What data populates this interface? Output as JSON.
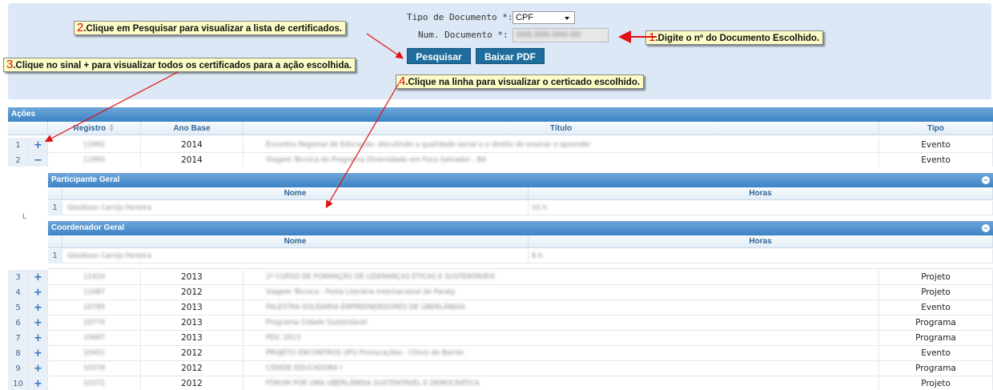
{
  "form": {
    "doc_type_label": "Tipo de Documento *:",
    "doc_type_value": "CPF",
    "doc_num_label": "Num. Documento *:",
    "doc_num_value": "000.000.000-00",
    "search_button": "Pesquisar",
    "pdf_button": "Baixar PDF"
  },
  "callouts": {
    "c1_num": "1",
    "c1_text": ".Digite o nº do Documento Escolhido.",
    "c2_num": "2",
    "c2_text": ".Clique em Pesquisar para visualizar a lista de certificados.",
    "c3_num": "3",
    "c3_text": ".Clique no sinal + para visualizar todos os certificados para a ação escolhida.",
    "c4_num": "4",
    "c4_text": ".Clique na linha para visualizar o certicado escolhido."
  },
  "grid": {
    "caption": "Ações",
    "columns": {
      "registro": "Registro",
      "sort_icon": "⇕",
      "ano_base": "Ano Base",
      "titulo": "Título",
      "tipo": "Tipo"
    },
    "rows": [
      {
        "index": "1",
        "toggle": "+",
        "registro": "11992",
        "ano": "2014",
        "titulo": "Encontro Regional de Educação: discutindo a qualidade social e o direito de ensinar e aprender",
        "tipo": "Evento"
      },
      {
        "index": "2",
        "toggle": "−",
        "registro": "11993",
        "ano": "2014",
        "titulo": "Viagem Técnica do Programa Diversidade em Foco Salvador - BA",
        "tipo": "Evento"
      },
      {
        "index": "3",
        "toggle": "+",
        "registro": "11424",
        "ano": "2013",
        "titulo": "1º CURSO DE FORMAÇÃO DE LIDERANÇAS ÉTICAS E SUSTENTÁVEIS",
        "tipo": "Projeto"
      },
      {
        "index": "4",
        "toggle": "+",
        "registro": "11087",
        "ano": "2012",
        "titulo": "Viagem Técnica - Festa Literária Internacional de Paraty",
        "tipo": "Projeto"
      },
      {
        "index": "5",
        "toggle": "+",
        "registro": "10785",
        "ano": "2013",
        "titulo": "PALESTRA SOLIDÁRIA EMPREENDEDORES DE UBERLÂNDIA",
        "tipo": "Evento"
      },
      {
        "index": "6",
        "toggle": "+",
        "registro": "10774",
        "ano": "2013",
        "titulo": "Programa Cidade Sustentável",
        "tipo": "Programa"
      },
      {
        "index": "7",
        "toggle": "+",
        "registro": "10687",
        "ano": "2013",
        "titulo": "PEIC 2013",
        "tipo": "Programa"
      },
      {
        "index": "8",
        "toggle": "+",
        "registro": "10401",
        "ano": "2012",
        "titulo": "PROJETO ENCONTROS UFU Provocações - Clóvis de Barros",
        "tipo": "Evento"
      },
      {
        "index": "9",
        "toggle": "+",
        "registro": "10378",
        "ano": "2012",
        "titulo": "CIDADE EDUCADORA I",
        "tipo": "Programa"
      },
      {
        "index": "10",
        "toggle": "+",
        "registro": "10371",
        "ano": "2012",
        "titulo": "FÓRUM POR UMA UBERLÂNDIA SUSTENTÁVEL E DEMOCRÁTICA",
        "tipo": "Projeto"
      }
    ]
  },
  "subgrids": {
    "indicator": "L",
    "collapse_icon": "−",
    "participante": {
      "title": "Participante Geral",
      "col_nome": "Nome",
      "col_horas": "Horas",
      "row_index": "1",
      "nome": "Gleidison Carrijo Ferreira",
      "horas": "10 h"
    },
    "coordenador": {
      "title": "Coordenador Geral",
      "col_nome": "Nome",
      "col_horas": "Horas",
      "row_index": "1",
      "nome": "Gleidison Carrijo Ferreira",
      "horas": "8 h"
    }
  },
  "colors": {
    "accent": "#1f6d9c",
    "header_blue": "#3c84c6",
    "panel_bg": "#dce8f5",
    "callout_bg": "#fcfcc6",
    "arrow_red": "#e01010"
  }
}
